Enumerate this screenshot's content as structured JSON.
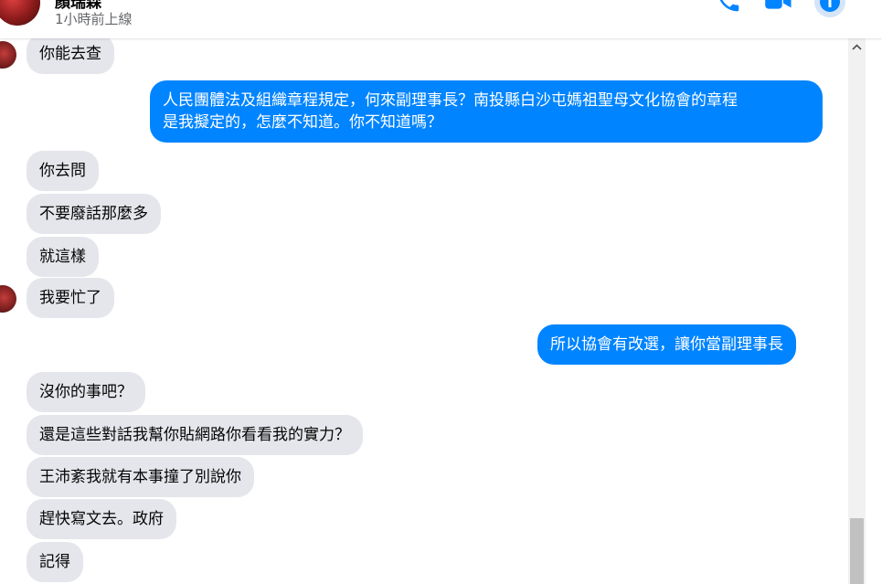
{
  "header": {
    "contact_name": "顏瑞森",
    "status": "1小時前上線",
    "icons": [
      "phone-icon",
      "video-camera-icon",
      "info-icon"
    ],
    "accent_color": "#0084ff"
  },
  "messages": [
    {
      "from": "them",
      "text": "你能去查"
    },
    {
      "from": "me",
      "lines": [
        "人民團體法及組織章程規定，何來副理事長？南投縣白沙屯媽祖聖母文化協會的章程",
        "是我擬定的，怎麼不知道。你不知道嗎？"
      ]
    },
    {
      "from": "them",
      "text": "你去問"
    },
    {
      "from": "them",
      "text": "不要廢話那麼多"
    },
    {
      "from": "them",
      "text": "就這樣"
    },
    {
      "from": "them",
      "text": "我要忙了"
    },
    {
      "from": "me",
      "text": "所以協會有改選，讓你當副理事長"
    },
    {
      "from": "them",
      "text": "沒你的事吧？"
    },
    {
      "from": "them",
      "text": "還是這些對話我幫你貼網路你看看我的實力？"
    },
    {
      "from": "them",
      "text": "王沛紊我就有本事撞了別說你"
    },
    {
      "from": "them",
      "text": "趕快寫文去。政府"
    },
    {
      "from": "them",
      "text": "記得"
    }
  ]
}
